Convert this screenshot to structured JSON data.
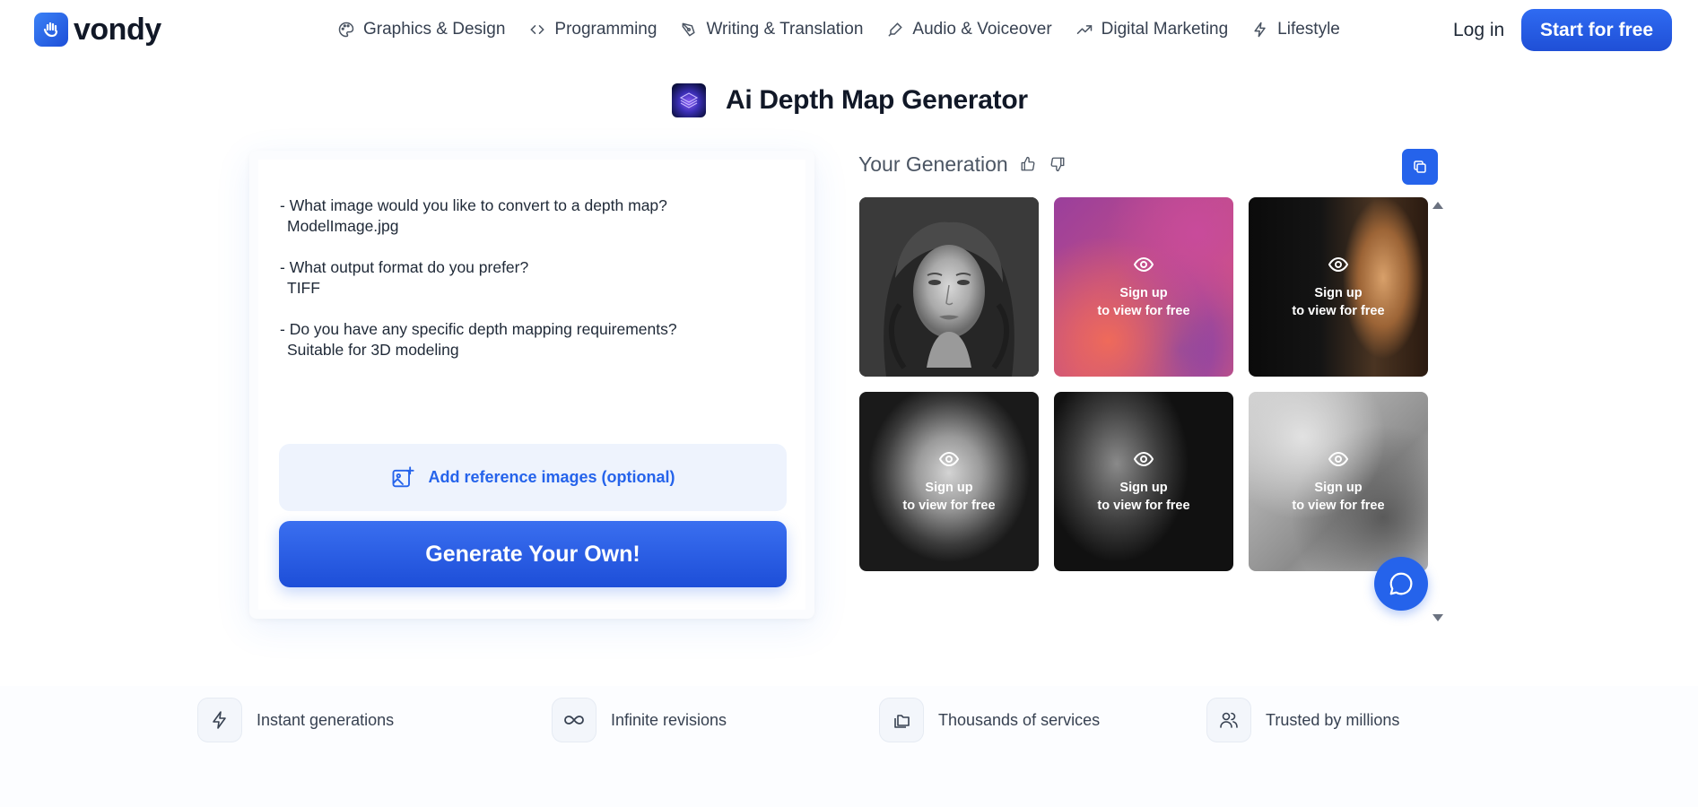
{
  "brand": {
    "name": "vondy"
  },
  "nav": {
    "items": [
      {
        "label": "Graphics & Design",
        "icon": "palette-icon"
      },
      {
        "label": "Programming",
        "icon": "code-icon"
      },
      {
        "label": "Writing & Translation",
        "icon": "pen-icon"
      },
      {
        "label": "Audio & Voiceover",
        "icon": "mic-icon"
      },
      {
        "label": "Digital Marketing",
        "icon": "trend-up-icon"
      },
      {
        "label": "Lifestyle",
        "icon": "bolt-icon"
      }
    ],
    "login": "Log in",
    "start": "Start for free"
  },
  "page": {
    "title": "Ai Depth Map Generator"
  },
  "prompt": {
    "blocks": [
      {
        "question": "- What image would you like to convert to a depth map?",
        "answer": "ModelImage.jpg"
      },
      {
        "question": "- What output format do you prefer?",
        "answer": "TIFF"
      },
      {
        "question": "- Do you have any specific depth mapping requirements?",
        "answer": "Suitable for 3D modeling"
      }
    ],
    "reference_label": "Add reference images (optional)",
    "generate_label": "Generate Your Own!"
  },
  "generation": {
    "title": "Your Generation",
    "locked": {
      "line1": "Sign up",
      "line2": "to view for free"
    }
  },
  "features": [
    {
      "label": "Instant generations",
      "icon": "bolt-icon"
    },
    {
      "label": "Infinite revisions",
      "icon": "infinity-icon"
    },
    {
      "label": "Thousands of services",
      "icon": "folders-icon"
    },
    {
      "label": "Trusted by millions",
      "icon": "users-icon"
    }
  ],
  "colors": {
    "accent": "#2563eb",
    "text": "#1f2937"
  }
}
